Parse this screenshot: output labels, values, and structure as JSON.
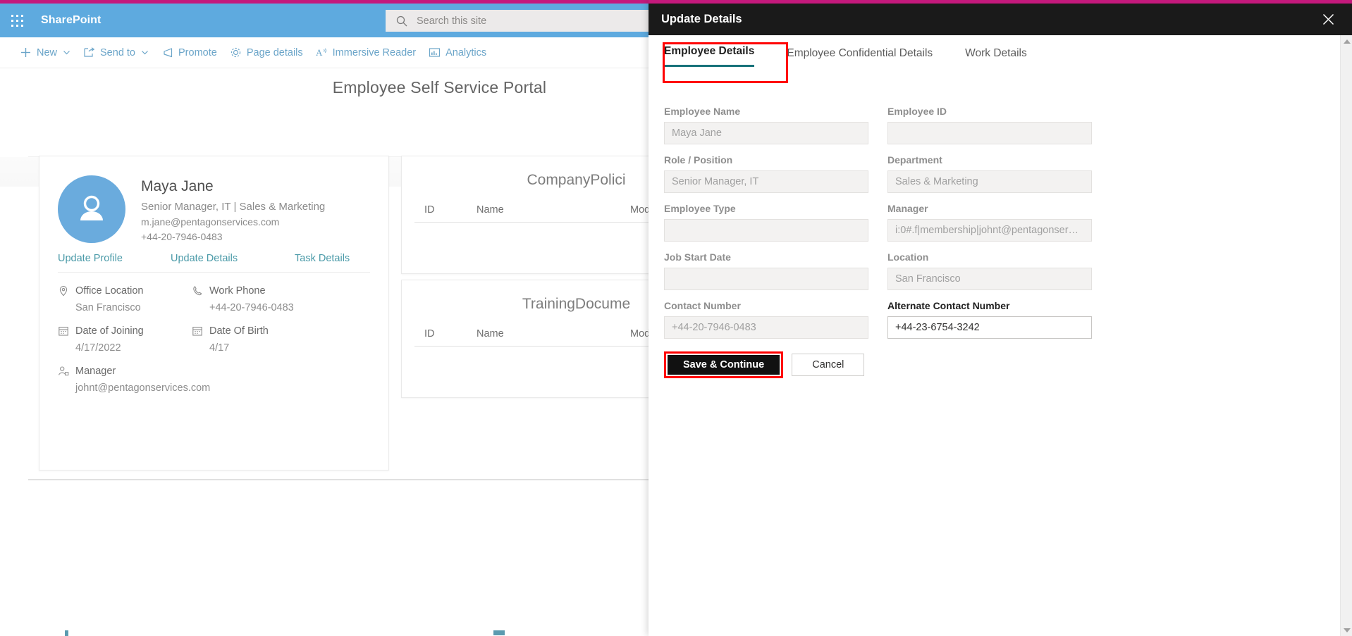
{
  "suite": {
    "brand": "SharePoint",
    "waffle_icon": "app-launcher-waffle-icon",
    "search": {
      "icon": "search-icon",
      "placeholder": "Search this site",
      "value": ""
    }
  },
  "command_bar": {
    "items": [
      {
        "label": "New",
        "icon": "plus-icon",
        "has_chevron": true
      },
      {
        "label": "Send to",
        "icon": "send-to-icon",
        "has_chevron": true
      },
      {
        "label": "Promote",
        "icon": "megaphone-icon",
        "has_chevron": false
      },
      {
        "label": "Page details",
        "icon": "gear-icon",
        "has_chevron": false
      },
      {
        "label": "Immersive Reader",
        "icon": "immersive-reader-icon",
        "has_chevron": false
      },
      {
        "label": "Analytics",
        "icon": "analytics-chart-icon",
        "has_chevron": false
      }
    ]
  },
  "page": {
    "title": "Employee Self Service Portal"
  },
  "profile_card": {
    "avatar_icon": "person-avatar-icon",
    "name": "Maya Jane",
    "role_line": "Senior Manager, IT | Sales  &  Marketing",
    "email": "m.jane@pentagonservices.com",
    "phone": "+44-20-7946-0483",
    "links": [
      {
        "label": "Update Profile"
      },
      {
        "label": "Update Details"
      },
      {
        "label": "Task Details"
      }
    ],
    "details": [
      {
        "icon": "location-pin-icon",
        "label": "Office Location",
        "value": "San Francisco"
      },
      {
        "icon": "phone-icon",
        "label": "Work Phone",
        "value": "+44-20-7946-0483"
      },
      {
        "icon": "calendar-icon",
        "label": "Date of Joining",
        "value": "4/17/2022"
      },
      {
        "icon": "calendar-icon",
        "label": "Date Of Birth",
        "value": "4/17"
      },
      {
        "icon": "manager-person-icon",
        "label": "Manager",
        "value": "johnt@pentagonservices.com"
      }
    ]
  },
  "list_webparts": [
    {
      "title": "CompanyPolici",
      "columns": [
        "ID",
        "Name",
        "Modified"
      ],
      "rows": []
    },
    {
      "title": "TrainingDocume",
      "columns": [
        "ID",
        "Name",
        "Modified"
      ],
      "rows": []
    }
  ],
  "panel": {
    "title": "Update Details",
    "close_icon": "close-icon",
    "tabs": [
      {
        "label": "Employee Details",
        "active": true,
        "highlighted": true
      },
      {
        "label": "Employee Confidential Details",
        "active": false,
        "highlighted": false
      },
      {
        "label": "Work Details",
        "active": false,
        "highlighted": false
      }
    ],
    "fields": [
      {
        "label": "Employee Name",
        "value": "Maya Jane",
        "enabled": false
      },
      {
        "label": "Employee ID",
        "value": "",
        "enabled": false
      },
      {
        "label": "Role / Position",
        "value": "Senior Manager, IT",
        "enabled": false
      },
      {
        "label": "Department",
        "value": "Sales  &  Marketing",
        "enabled": false
      },
      {
        "label": "Employee Type",
        "value": "",
        "enabled": false
      },
      {
        "label": "Manager",
        "value": "i:0#.f|membership|johnt@pentagonser…",
        "enabled": false
      },
      {
        "label": "Job Start Date",
        "value": "",
        "enabled": false
      },
      {
        "label": "Location",
        "value": "San Francisco",
        "enabled": false
      },
      {
        "label": "Contact Number",
        "value": "+44-20-7946-0483",
        "enabled": false
      },
      {
        "label": "Alternate Contact Number",
        "value": "+44-23-6754-3242",
        "enabled": true
      }
    ],
    "buttons": {
      "primary": "Save & Continue",
      "secondary": "Cancel"
    },
    "scrollbar": {
      "up_icon": "scroll-up-arrow-icon",
      "down_icon": "scroll-down-arrow-icon"
    }
  },
  "colors": {
    "accent_magenta": "#c4197c",
    "suite_blue": "#5eaadf",
    "link_teal": "#4a9aa8",
    "tab_underline": "#17727a",
    "highlight_red": "#ff0000",
    "panel_header": "#1a1a1a",
    "avatar_blue": "#6aabdd"
  }
}
